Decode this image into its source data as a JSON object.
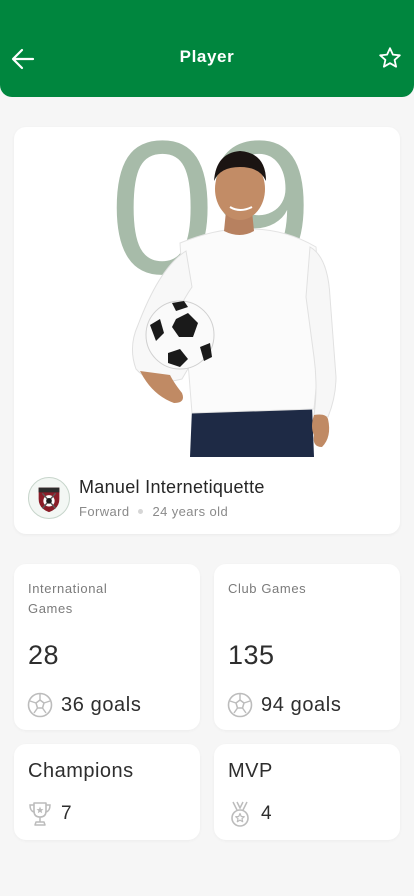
{
  "colors": {
    "primary": "#00863e",
    "jersey_number": "#a7bba9",
    "background": "#f6f6f6"
  },
  "header": {
    "title": "Player",
    "back_icon": "arrow-left-icon",
    "favorite_icon": "star-outline-icon"
  },
  "player": {
    "number": "09",
    "name": "Manuel Internetiquette",
    "position": "Forward",
    "age": "24 years old",
    "club_badge_icon": "club-crest-icon"
  },
  "stats": {
    "international": {
      "label": "International Games",
      "games": "28",
      "goals": "36 goals",
      "icon": "soccer-ball-icon"
    },
    "club": {
      "label": "Club Games",
      "games": "135",
      "goals": "94 goals",
      "icon": "soccer-ball-icon"
    }
  },
  "awards": {
    "champions": {
      "label": "Champions",
      "count": "7",
      "icon": "trophy-icon"
    },
    "mvp": {
      "label": "MVP",
      "count": "4",
      "icon": "medal-icon"
    }
  }
}
